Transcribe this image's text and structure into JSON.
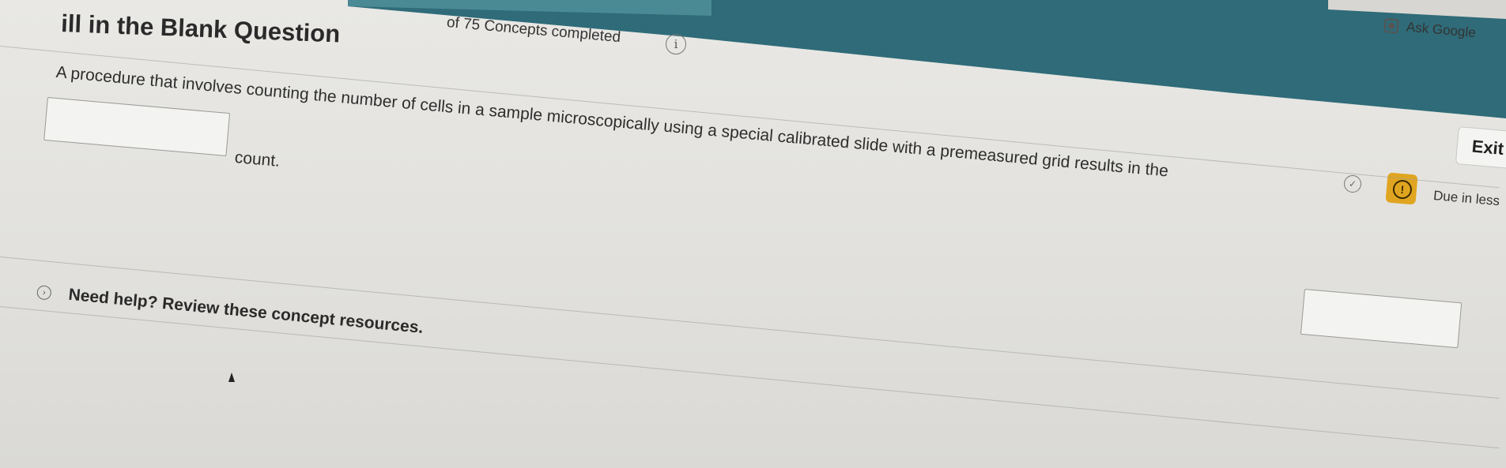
{
  "header": {
    "question_type": "ill in the Blank Question",
    "concepts_progress": "of 75 Concepts completed",
    "info_icon": "i",
    "ask_google": "Ask Google",
    "exit_label": "Exit",
    "check_icon": "✓",
    "alert_icon": "!",
    "due_text": "Due in less"
  },
  "question": {
    "sentence": "A procedure that involves counting the number of cells in a sample microscopically using a special calibrated slide with a premeasured grid results in the",
    "blank_1_value": "",
    "blank_1_suffix": "count.",
    "blank_2_value": ""
  },
  "help": {
    "toggle_icon": "›",
    "text": "Need help? Review these concept resources."
  },
  "colors": {
    "header_teal": "#2f6b78",
    "header_teal_light": "#4a8a95",
    "alert_badge": "#e0a520",
    "background": "#e3e2df"
  }
}
